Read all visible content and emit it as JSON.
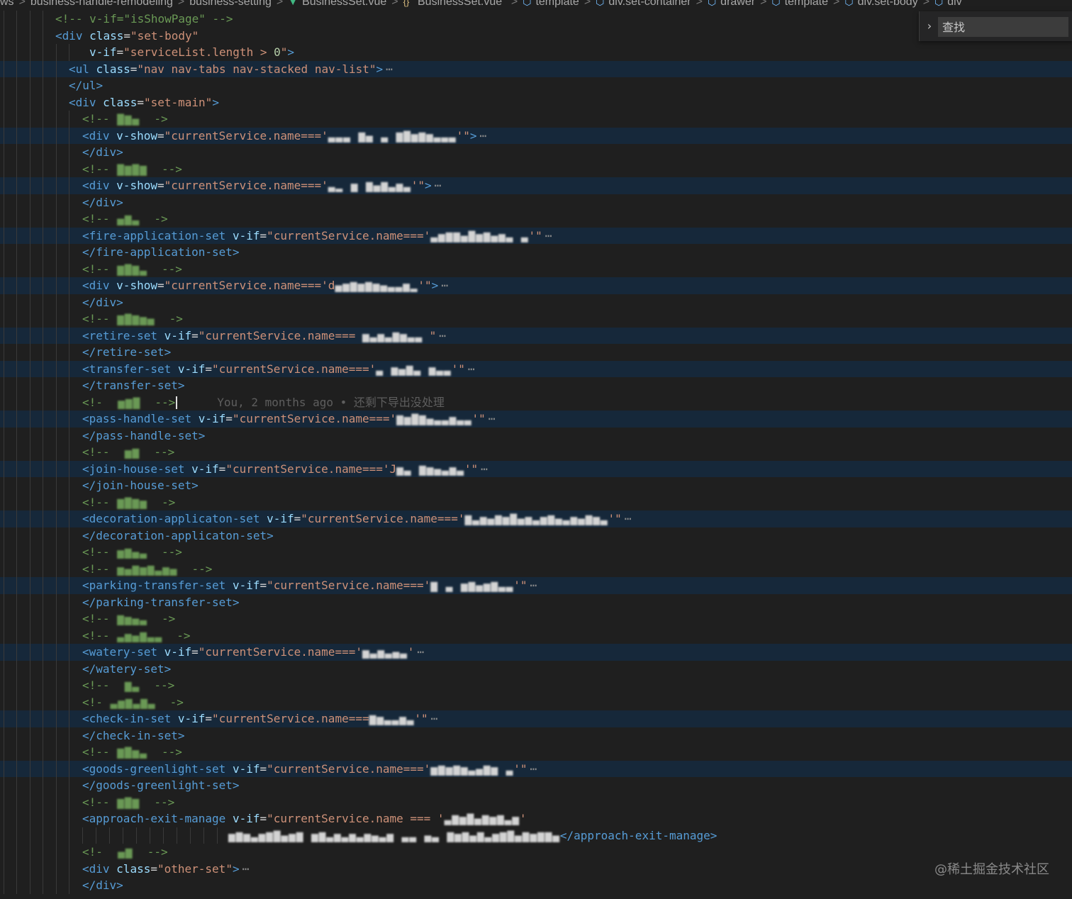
{
  "breadcrumb": {
    "items": [
      "ws",
      "business-handle-remodeling",
      "business-setting",
      "BusinessSet.vue",
      "\"BusinessSet.vue\"",
      "template",
      "div.set-container",
      "drawer",
      "template",
      "div.set-body",
      "div"
    ]
  },
  "find": {
    "placeholder": "查找"
  },
  "watermark": "@稀土掘金技术社区",
  "blame": "You, 2 months ago • 还剩下导出没处理",
  "lines": [
    {
      "indent": 78,
      "segs": [
        [
          "cm",
          "<!-- v-if=\"isShowPage\" -->"
        ]
      ]
    },
    {
      "indent": 78,
      "segs": [
        [
          "tag",
          "<div"
        ],
        [
          "",
          " "
        ],
        [
          "attr",
          "class"
        ],
        [
          "",
          "="
        ],
        [
          "str",
          "\"set-body\""
        ]
      ]
    },
    {
      "indent": 126,
      "segs": [
        [
          "attr",
          "v-if"
        ],
        [
          "",
          "="
        ],
        [
          "str",
          "\"serviceList.length > "
        ],
        [
          "num",
          "0"
        ],
        [
          "str",
          "\""
        ],
        [
          "tag",
          ">"
        ]
      ]
    },
    {
      "indent": 97,
      "hl": true,
      "segs": [
        [
          "tag",
          "<ul"
        ],
        [
          "",
          " "
        ],
        [
          "attr",
          "class"
        ],
        [
          "",
          "="
        ],
        [
          "str",
          "\"nav nav-tabs nav-stacked nav-list\""
        ],
        [
          "tag",
          ">"
        ],
        [
          "fold",
          "⋯"
        ]
      ]
    },
    {
      "indent": 97,
      "segs": [
        [
          "tag",
          "</ul>"
        ]
      ]
    },
    {
      "indent": 97,
      "segs": [
        [
          "tag",
          "<div"
        ],
        [
          "",
          " "
        ],
        [
          "attr",
          "class"
        ],
        [
          "",
          "="
        ],
        [
          "str",
          "\"set-main\""
        ],
        [
          "tag",
          ">"
        ]
      ]
    },
    {
      "indent": 116,
      "segs": [
        [
          "cm",
          "<!--"
        ],
        [
          "blur cm",
          " ▇▆▄ "
        ],
        [
          "cm",
          " ->"
        ]
      ]
    },
    {
      "indent": 116,
      "hl": true,
      "segs": [
        [
          "tag",
          "<div"
        ],
        [
          "",
          " "
        ],
        [
          "attr",
          "v-show"
        ],
        [
          "",
          "="
        ],
        [
          "str",
          "\"currentService.name==='"
        ],
        [
          "blur plain",
          "▃▃▃ ▆▄ ▃ ▆▇▅▆▅▃▃▃"
        ],
        [
          "str",
          "'\""
        ],
        [
          "tag",
          ">"
        ],
        [
          "fold",
          "⋯"
        ]
      ]
    },
    {
      "indent": 116,
      "segs": [
        [
          "tag",
          "</div>"
        ]
      ]
    },
    {
      "indent": 116,
      "segs": [
        [
          "cm",
          "<!--"
        ],
        [
          "blur cm",
          " ▇▆▇▆ "
        ],
        [
          "cm",
          " -->"
        ]
      ]
    },
    {
      "indent": 116,
      "hl": true,
      "segs": [
        [
          "tag",
          "<div"
        ],
        [
          "",
          " "
        ],
        [
          "attr",
          "v-show"
        ],
        [
          "",
          "="
        ],
        [
          "str",
          "\"currentService.name==='"
        ],
        [
          "blur plain",
          "▃▂ ▅ ▆▄▆▃▅▃"
        ],
        [
          "str",
          "'\""
        ],
        [
          "tag",
          ">"
        ],
        [
          "fold",
          "⋯"
        ]
      ]
    },
    {
      "indent": 116,
      "segs": [
        [
          "tag",
          "</div>"
        ]
      ]
    },
    {
      "indent": 116,
      "segs": [
        [
          "cm",
          "<!--"
        ],
        [
          "blur cm",
          " ▄▆▃ "
        ],
        [
          "cm",
          " ->"
        ]
      ]
    },
    {
      "indent": 116,
      "hl": true,
      "segs": [
        [
          "tag",
          "<fire-application-set"
        ],
        [
          "",
          " "
        ],
        [
          "attr",
          "v-if"
        ],
        [
          "",
          "="
        ],
        [
          "str",
          "\"currentService.name==='"
        ],
        [
          "blur plain",
          "▃▅▆▆▄▇▅▆▄▅▃ ▃"
        ],
        [
          "str",
          "'\""
        ],
        [
          "fold",
          "⋯"
        ]
      ]
    },
    {
      "indent": 116,
      "segs": [
        [
          "tag",
          "</fire-application-set>"
        ]
      ]
    },
    {
      "indent": 116,
      "segs": [
        [
          "cm",
          "<!--"
        ],
        [
          "blur cm",
          " ▆▇▆▃ "
        ],
        [
          "cm",
          " -->"
        ]
      ]
    },
    {
      "indent": 116,
      "hl": true,
      "segs": [
        [
          "tag",
          "<div"
        ],
        [
          "",
          " "
        ],
        [
          "attr",
          "v-show"
        ],
        [
          "",
          "="
        ],
        [
          "str",
          "\"currentService.name==='d"
        ],
        [
          "blur plain",
          "▄▅▆▅▆▅▄▃▃▅▂"
        ],
        [
          "str",
          "'\""
        ],
        [
          "tag",
          ">"
        ],
        [
          "fold",
          "⋯"
        ]
      ]
    },
    {
      "indent": 116,
      "segs": [
        [
          "tag",
          "</div>"
        ]
      ]
    },
    {
      "indent": 116,
      "segs": [
        [
          "cm",
          "<!--"
        ],
        [
          "blur cm",
          " ▆▇▆▅▄ "
        ],
        [
          "cm",
          " ->"
        ]
      ]
    },
    {
      "indent": 116,
      "hl": true,
      "segs": [
        [
          "tag",
          "<retire-set"
        ],
        [
          "",
          " "
        ],
        [
          "attr",
          "v-if"
        ],
        [
          "",
          "="
        ],
        [
          "str",
          "\"currentService.name=== "
        ],
        [
          "blur plain",
          "▅▃▅▃▆▅▃▃"
        ],
        [
          "str",
          " \""
        ],
        [
          "fold",
          "⋯"
        ]
      ]
    },
    {
      "indent": 116,
      "segs": [
        [
          "tag",
          "</retire-set>"
        ]
      ]
    },
    {
      "indent": 116,
      "hl": true,
      "segs": [
        [
          "tag",
          "<transfer-set"
        ],
        [
          "",
          " "
        ],
        [
          "attr",
          "v-if"
        ],
        [
          "",
          "="
        ],
        [
          "str",
          "\"currentService.name==='"
        ],
        [
          "blur plain",
          "▃ ▅▄▆▃ ▅▃▃"
        ],
        [
          "str",
          "'\""
        ],
        [
          "fold",
          "⋯"
        ]
      ]
    },
    {
      "indent": 116,
      "segs": [
        [
          "tag",
          "</transfer-set>"
        ]
      ]
    },
    {
      "indent": 116,
      "blame": true,
      "segs": [
        [
          "cm",
          "<!-"
        ],
        [
          "blur cm",
          "  ▅▆▇ "
        ],
        [
          "cm",
          " -->"
        ]
      ]
    },
    {
      "indent": 116,
      "hl": true,
      "segs": [
        [
          "tag",
          "<pass-handle-set"
        ],
        [
          "",
          " "
        ],
        [
          "attr",
          "v-if"
        ],
        [
          "",
          "="
        ],
        [
          "str",
          "\"currentService.name==='"
        ],
        [
          "blur plain",
          "▆▅▇▆▄▃▃▅▃▃"
        ],
        [
          "str",
          "'\""
        ],
        [
          "fold",
          "⋯"
        ]
      ]
    },
    {
      "indent": 116,
      "segs": [
        [
          "tag",
          "</pass-handle-set>"
        ]
      ]
    },
    {
      "indent": 116,
      "segs": [
        [
          "cm",
          "<!--"
        ],
        [
          "blur cm",
          "  ▅▆ "
        ],
        [
          "cm",
          " -->"
        ]
      ]
    },
    {
      "indent": 116,
      "hl": true,
      "segs": [
        [
          "tag",
          "<join-house-set"
        ],
        [
          "",
          " "
        ],
        [
          "attr",
          "v-if"
        ],
        [
          "",
          "="
        ],
        [
          "str",
          "\"currentService.name==='J"
        ],
        [
          "blur plain",
          "▅▃ ▆▅▄▃▅▃"
        ],
        [
          "str",
          "'\""
        ],
        [
          "fold",
          "⋯"
        ]
      ]
    },
    {
      "indent": 116,
      "segs": [
        [
          "tag",
          "</join-house-set>"
        ]
      ]
    },
    {
      "indent": 116,
      "segs": [
        [
          "cm",
          "<!--"
        ],
        [
          "blur cm",
          " ▆▇▆▅ "
        ],
        [
          "cm",
          " ->"
        ]
      ]
    },
    {
      "indent": 116,
      "hl": true,
      "segs": [
        [
          "tag",
          "<decoration-applicaton-set"
        ],
        [
          "",
          " "
        ],
        [
          "attr",
          "v-if"
        ],
        [
          "",
          "="
        ],
        [
          "str",
          "\"currentService.name==='"
        ],
        [
          "blur plain",
          "▆▃▅▄▆▅▇▄▅▃▅▆▄▃▅▄▆▅▃"
        ],
        [
          "str",
          "'\""
        ],
        [
          "fold",
          "⋯"
        ]
      ]
    },
    {
      "indent": 116,
      "segs": [
        [
          "tag",
          "</decoration-applicaton-set>"
        ]
      ]
    },
    {
      "indent": 116,
      "segs": [
        [
          "cm",
          "<!--"
        ],
        [
          "blur cm",
          " ▅▆▄▃ "
        ],
        [
          "cm",
          " -->"
        ]
      ]
    },
    {
      "indent": 116,
      "segs": [
        [
          "cm",
          "<!--"
        ],
        [
          "blur cm",
          " ▅▄▆▅▆▃▅▄ "
        ],
        [
          "cm",
          " -->"
        ]
      ]
    },
    {
      "indent": 116,
      "hl": true,
      "segs": [
        [
          "tag",
          "<parking-transfer-set"
        ],
        [
          "",
          " "
        ],
        [
          "attr",
          "v-if"
        ],
        [
          "",
          "="
        ],
        [
          "str",
          "\"currentService.name==='"
        ],
        [
          "blur plain",
          "▆ ▃ ▅▆▄▅▆▃▃"
        ],
        [
          "str",
          "'\""
        ],
        [
          "fold",
          "⋯"
        ]
      ]
    },
    {
      "indent": 116,
      "segs": [
        [
          "tag",
          "</parking-transfer-set>"
        ]
      ]
    },
    {
      "indent": 116,
      "segs": [
        [
          "cm",
          "<!--"
        ],
        [
          "blur cm",
          " ▆▅▄▃ "
        ],
        [
          "cm",
          " ->"
        ]
      ]
    },
    {
      "indent": 116,
      "segs": [
        [
          "cm",
          "<!--"
        ],
        [
          "blur cm",
          " ▃▅▄▆▃▃ "
        ],
        [
          "cm",
          " ->"
        ]
      ]
    },
    {
      "indent": 116,
      "hl": true,
      "segs": [
        [
          "tag",
          "<watery-set"
        ],
        [
          "",
          " "
        ],
        [
          "attr",
          "v-if"
        ],
        [
          "",
          "="
        ],
        [
          "str",
          "\"currentService.name==='"
        ],
        [
          "blur plain",
          "▅▃▅▃▄▃"
        ],
        [
          "str",
          "'"
        ],
        [
          "fold",
          "⋯"
        ]
      ]
    },
    {
      "indent": 116,
      "segs": [
        [
          "tag",
          "</watery-set>"
        ]
      ]
    },
    {
      "indent": 116,
      "segs": [
        [
          "cm",
          "<!--"
        ],
        [
          "blur cm",
          "  ▆▃ "
        ],
        [
          "cm",
          " -->"
        ]
      ]
    },
    {
      "indent": 116,
      "segs": [
        [
          "cm",
          "<!-"
        ],
        [
          "blur cm",
          " ▃▅▆▃▆▃ "
        ],
        [
          "cm",
          " ->"
        ]
      ]
    },
    {
      "indent": 116,
      "hl": true,
      "segs": [
        [
          "tag",
          "<check-in-set"
        ],
        [
          "",
          " "
        ],
        [
          "attr",
          "v-if"
        ],
        [
          "",
          "="
        ],
        [
          "str",
          "\"currentService.name==="
        ],
        [
          "blur plain",
          "▆▅▃▃▅▃"
        ],
        [
          "str",
          "'\""
        ],
        [
          "fold",
          "⋯"
        ]
      ]
    },
    {
      "indent": 116,
      "segs": [
        [
          "tag",
          "</check-in-set>"
        ]
      ]
    },
    {
      "indent": 116,
      "segs": [
        [
          "cm",
          "<!--"
        ],
        [
          "blur cm",
          " ▆▇▅▃ "
        ],
        [
          "cm",
          " -->"
        ]
      ]
    },
    {
      "indent": 116,
      "hl": true,
      "segs": [
        [
          "tag",
          "<goods-greenlight-set"
        ],
        [
          "",
          " "
        ],
        [
          "attr",
          "v-if"
        ],
        [
          "",
          "="
        ],
        [
          "str",
          "\"currentService.name==='"
        ],
        [
          "blur plain",
          "▅▆▅▆▅▃▄▆▅ ▃"
        ],
        [
          "str",
          "'\""
        ],
        [
          "fold",
          "⋯"
        ]
      ]
    },
    {
      "indent": 116,
      "segs": [
        [
          "tag",
          "</goods-greenlight-set>"
        ]
      ]
    },
    {
      "indent": 116,
      "segs": [
        [
          "cm",
          "<!--"
        ],
        [
          "blur cm",
          " ▆▇▆ "
        ],
        [
          "cm",
          " -->"
        ]
      ]
    },
    {
      "indent": 116,
      "segs": [
        [
          "tag",
          "<approach-exit-manage"
        ],
        [
          "",
          " "
        ],
        [
          "attr",
          "v-if"
        ],
        [
          "",
          "="
        ],
        [
          "str",
          "\"currentService.name === '"
        ],
        [
          "blur plain",
          "▃▆▅▇▄▆▅▆▃▅"
        ],
        [
          "str",
          "'"
        ]
      ]
    },
    {
      "indent": 322,
      "segs": [
        [
          "blur plain",
          "▅▆▅▃▅▆▇▄▅▆ ▅▆▃▅▃▅▃▅▄▃▅ ▃▃ ▄▃ ▆▅▆▄▆▃▅▆▇▄▆▅▆▆▄"
        ],
        [
          "tag",
          "</approach-exit-manage>"
        ]
      ]
    },
    {
      "indent": 116,
      "segs": [
        [
          "cm",
          "<!-"
        ],
        [
          "blur cm",
          "  ▄▆ "
        ],
        [
          "cm",
          " -->"
        ]
      ]
    },
    {
      "indent": 116,
      "segs": [
        [
          "tag",
          "<div"
        ],
        [
          "",
          " "
        ],
        [
          "attr",
          "class"
        ],
        [
          "",
          "="
        ],
        [
          "str",
          "\"other-set\""
        ],
        [
          "tag",
          ">"
        ],
        [
          "fold",
          "⋯"
        ]
      ]
    },
    {
      "indent": 116,
      "segs": [
        [
          "tag",
          "</div>"
        ]
      ]
    }
  ]
}
